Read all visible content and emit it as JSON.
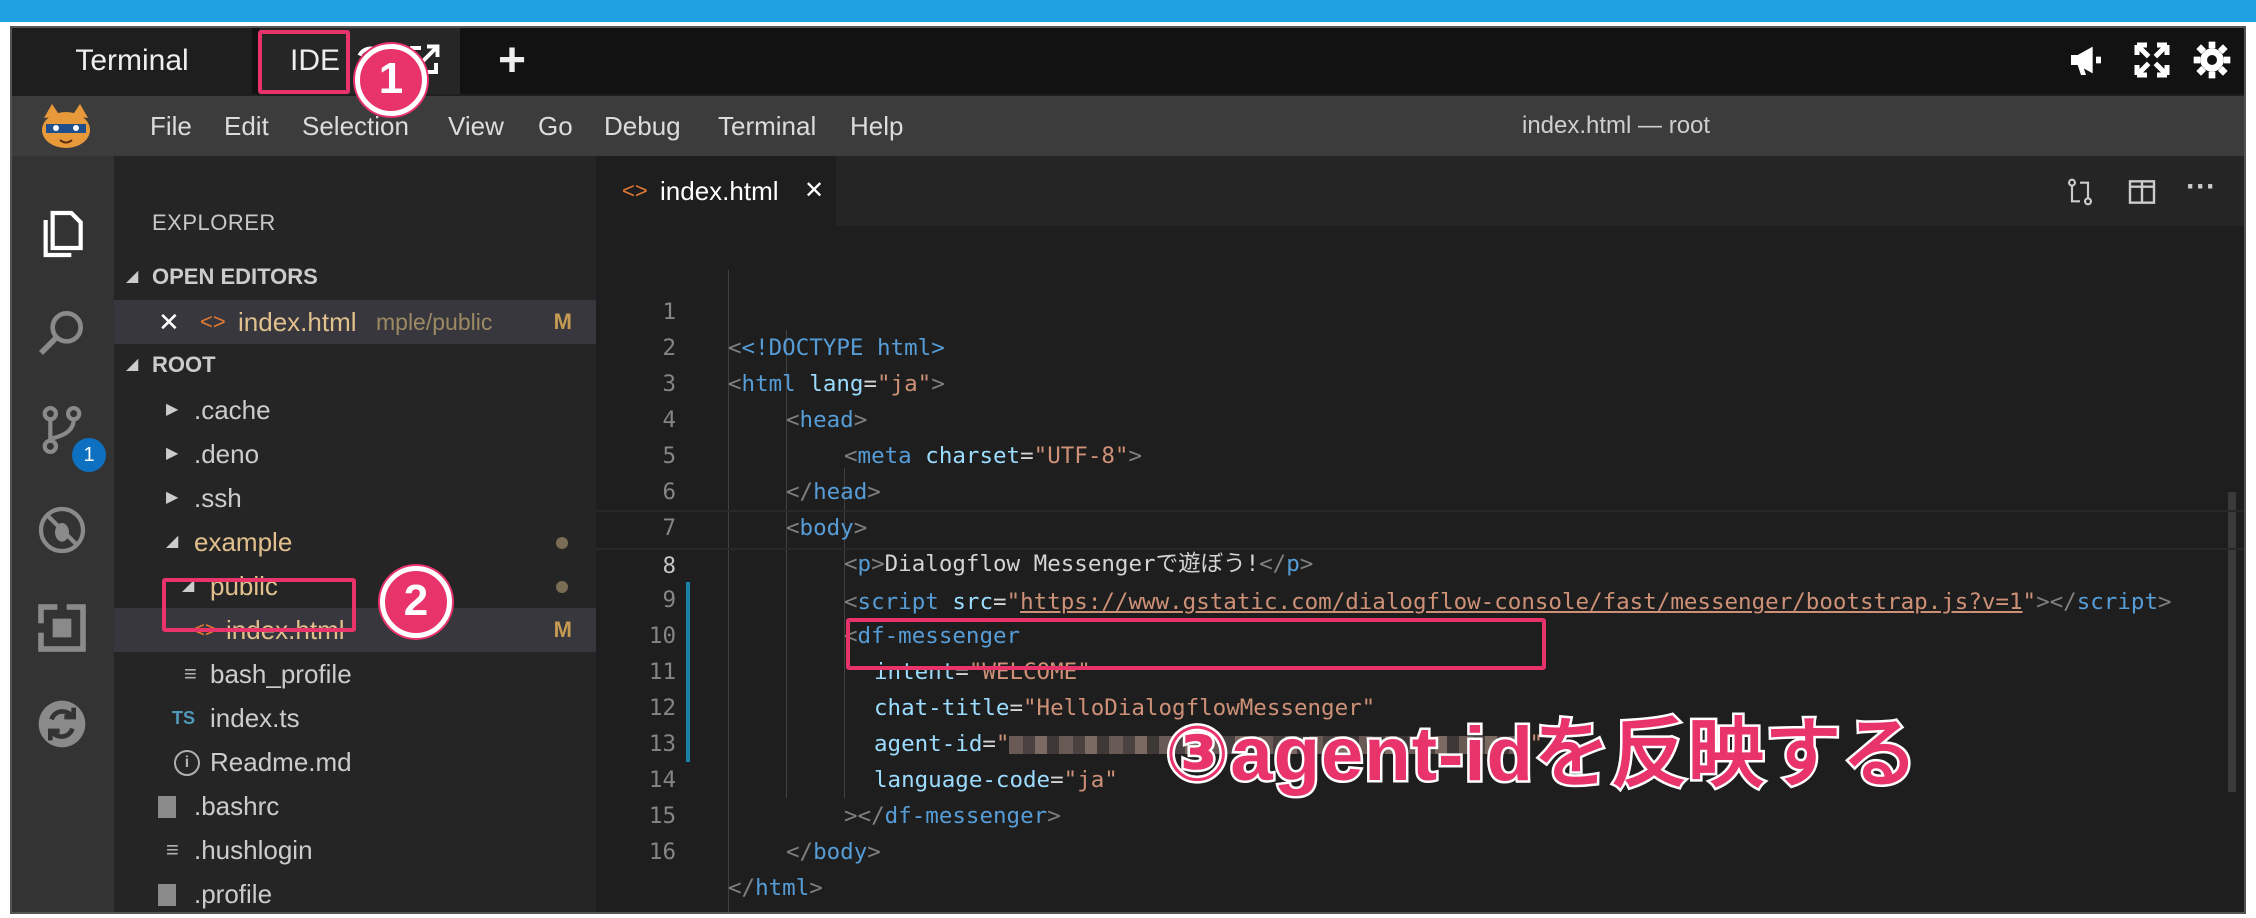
{
  "top_tabs": {
    "terminal": "Terminal",
    "ide": "IDE",
    "add": "+"
  },
  "menu": [
    "File",
    "Edit",
    "Selection",
    "View",
    "Go",
    "Debug",
    "Terminal",
    "Help"
  ],
  "window_title": "index.html — root",
  "activity": {
    "scm_badge": "1"
  },
  "explorer": {
    "title": "EXPLORER",
    "open_editors_label": "OPEN EDITORS",
    "open_editor": {
      "name": "index.html",
      "path": "mple/public",
      "status": "M"
    },
    "root_label": "ROOT",
    "tree": [
      {
        "name": ".cache"
      },
      {
        "name": ".deno"
      },
      {
        "name": ".ssh"
      },
      {
        "name": "example"
      },
      {
        "name": "public"
      },
      {
        "name": "index.html",
        "status": "M"
      },
      {
        "name": "bash_profile"
      },
      {
        "name": "index.ts",
        "icon_text": "TS"
      },
      {
        "name": "Readme.md"
      },
      {
        "name": ".bashrc"
      },
      {
        "name": ".hushlogin"
      },
      {
        "name": ".profile"
      }
    ]
  },
  "editor": {
    "tab_label": "index.html",
    "lines": [
      {
        "n": "1"
      },
      {
        "n": "2"
      },
      {
        "n": "3"
      },
      {
        "n": "4"
      },
      {
        "n": "5"
      },
      {
        "n": "6"
      },
      {
        "n": "7"
      },
      {
        "n": "8"
      },
      {
        "n": "9"
      },
      {
        "n": "10"
      },
      {
        "n": "11"
      },
      {
        "n": "12"
      },
      {
        "n": "13"
      },
      {
        "n": "14"
      },
      {
        "n": "15"
      },
      {
        "n": "16"
      }
    ],
    "code": {
      "doctype": "<!DOCTYPE html>",
      "html_open_tag": "html",
      "lang_attr": "lang",
      "lang_val": "\"ja\"",
      "head": "head",
      "meta": "meta",
      "charset_attr": "charset",
      "charset_val": "\"UTF-8\"",
      "body": "body",
      "p": "p",
      "p_text": "Dialogflow Messengerで遊ぼう!",
      "script": "script",
      "src_attr": "src",
      "src_url": "https://www.gstatic.com/dialogflow-console/fast/messenger/bootstrap.js?v=1",
      "df_messenger": "df-messenger",
      "intent_attr": "intent",
      "intent_val": "\"WELCOME\"",
      "chat_title_attr": "chat-title",
      "chat_title_val": "\"HelloDialogflowMessenger\"",
      "agent_id_attr": "agent-id",
      "language_code_attr": "language-code",
      "language_code_val": "\"ja\""
    }
  },
  "annotations": {
    "n1": "1",
    "n2": "2",
    "callout3": "③agent-idを反映する"
  },
  "colors": {
    "annotation": "#e8336b",
    "tag": "#569cd6",
    "attribute": "#9cdcfe",
    "string": "#ce9178"
  }
}
